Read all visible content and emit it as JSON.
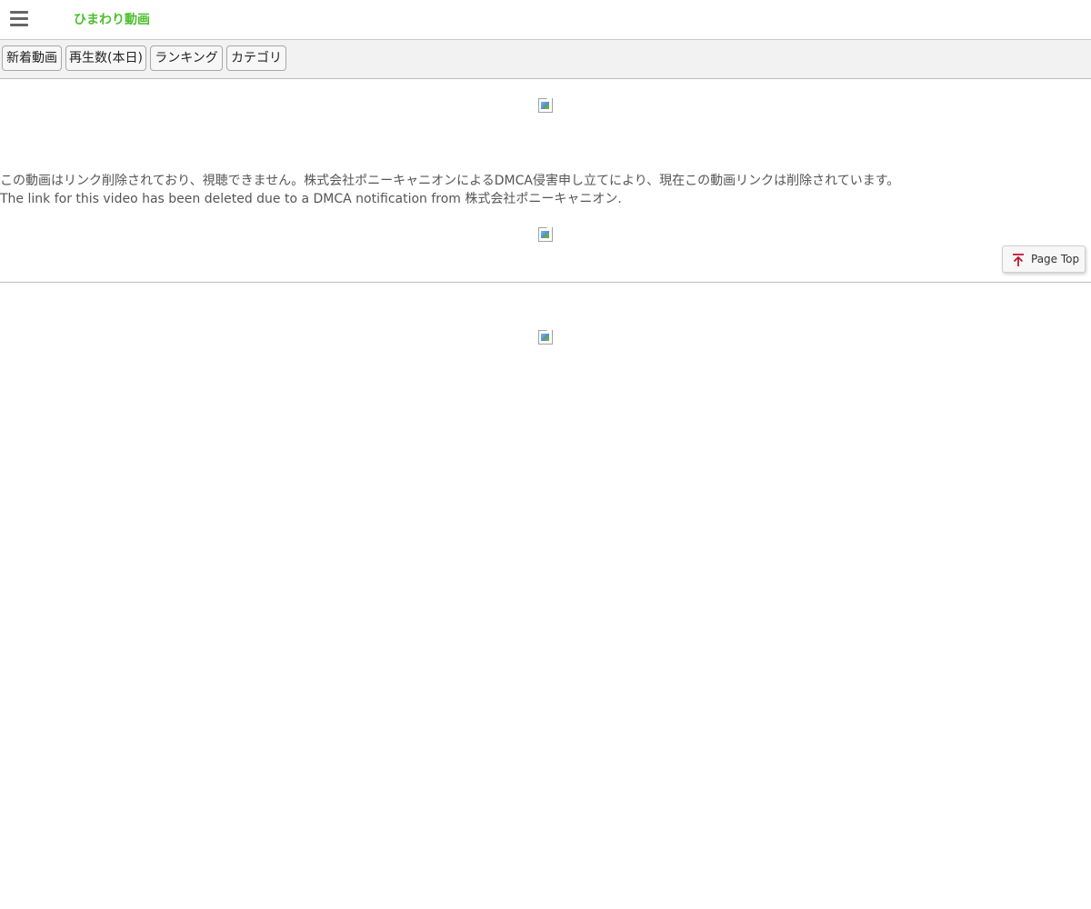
{
  "header": {
    "menu_icon": "hamburger-menu-icon",
    "logo_text": "ひまわり動画",
    "logo_color": "#4cbf2e"
  },
  "tabs": [
    {
      "label": "新着動画"
    },
    {
      "label": "再生数(本日)"
    },
    {
      "label": "ランキング"
    },
    {
      "label": "カテゴリ"
    }
  ],
  "main": {
    "notice_ja": "この動画はリンク削除されており、視聴できません。株式会社ポニーキャニオンによるDMCA侵害申し立てにより、現在この動画リンクは削除されています。",
    "notice_en": "The link for this video has been deleted due to a DMCA notification from 株式会社ポニーキャニオン.",
    "broken_image_icon": "broken-image-icon"
  },
  "page_top": {
    "label": "Page Top",
    "icon": "arrow-up-icon",
    "icon_color": "#c0152f"
  }
}
